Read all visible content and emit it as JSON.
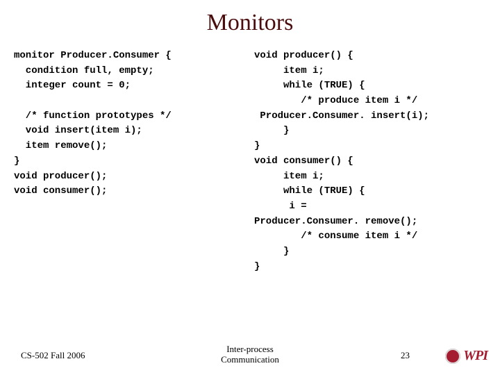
{
  "title": "Monitors",
  "left_code": "monitor Producer.Consumer {\n  condition full, empty;\n  integer count = 0;\n\n  /* function prototypes */\n  void insert(item i);\n  item remove();\n}\nvoid producer();\nvoid consumer();",
  "right_code": "void producer() {\n     item i;\n     while (TRUE) {\n        /* produce item i */\n Producer.Consumer. insert(i);\n     }\n}\nvoid consumer() {\n     item i;\n     while (TRUE) {\n      i =\nProducer.Consumer. remove();\n        /* consume item i */\n     }\n}",
  "footer": {
    "left": "CS-502 Fall 2006",
    "center_line1": "Inter-process",
    "center_line2": "Communication",
    "page": "23",
    "logo_text": "WPI"
  }
}
